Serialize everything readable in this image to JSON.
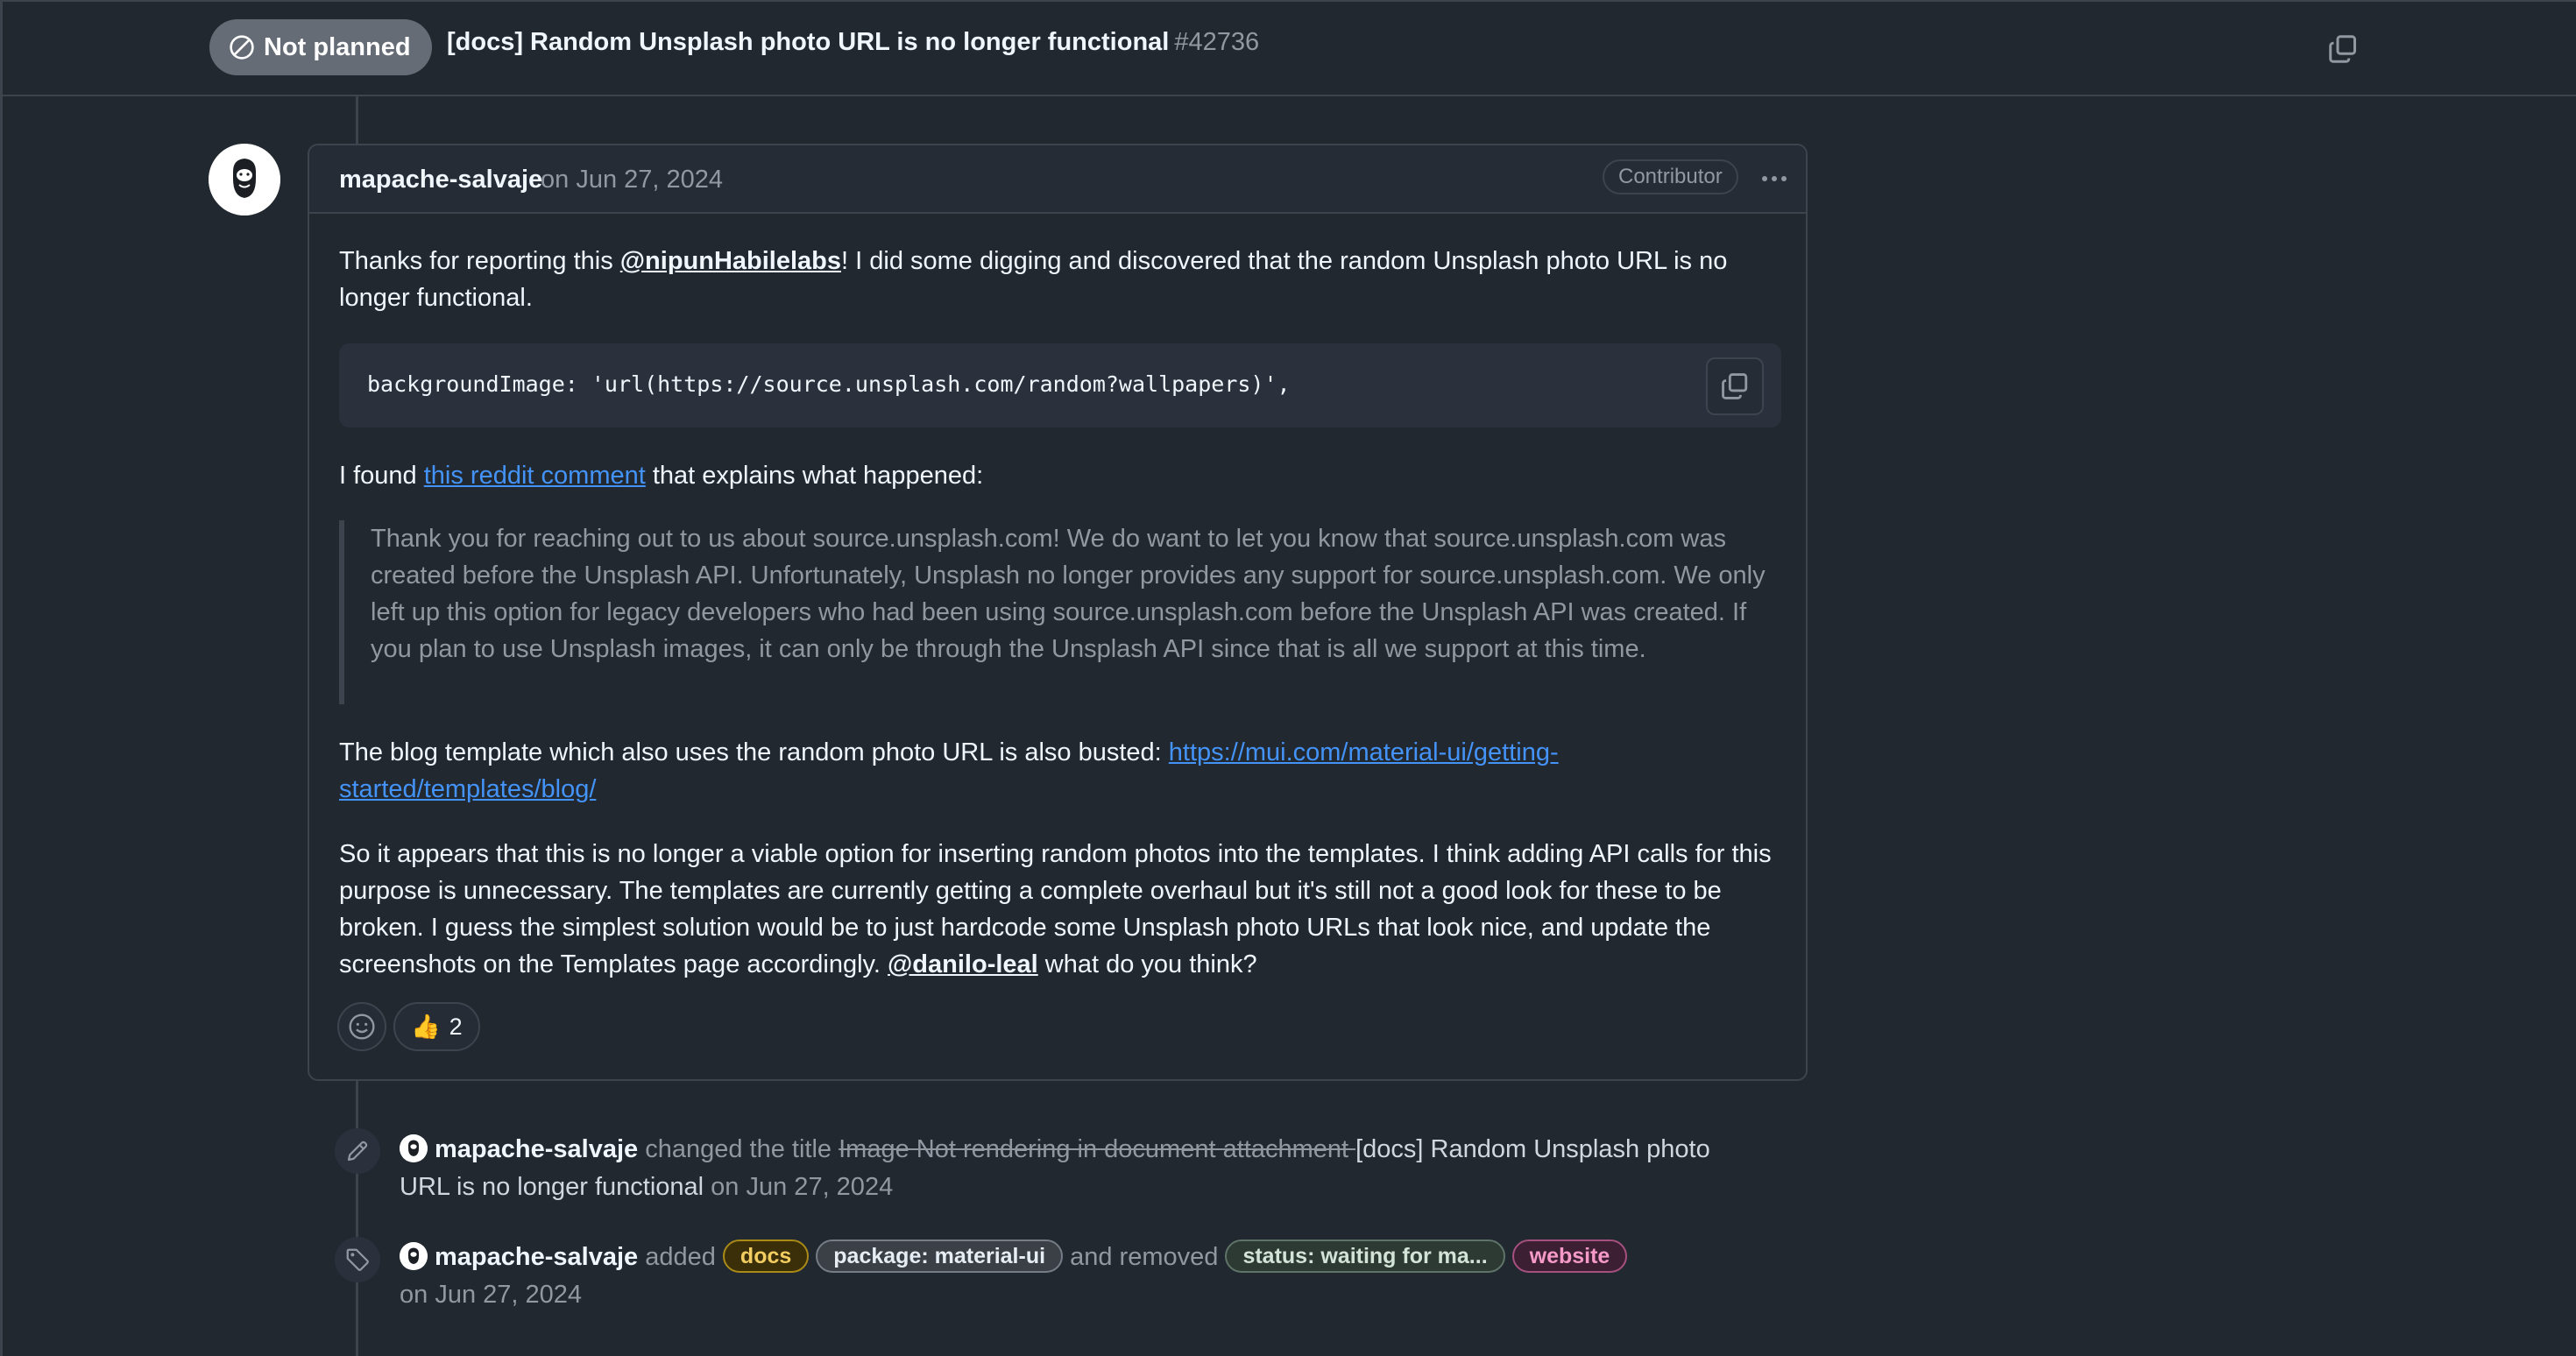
{
  "header": {
    "state": "Not planned",
    "title": "[docs] Random Unsplash photo URL is no longer functional",
    "number": "#42736"
  },
  "comment": {
    "author": "mapache-salvaje",
    "date": "on Jun 27, 2024",
    "role_badge": "Contributor",
    "p1_before": "Thanks for reporting this ",
    "p1_mention": "@nipunHabilelabs",
    "p1_after": "! I did some digging and discovered that the random Unsplash photo URL is no longer functional.",
    "code": "backgroundImage: 'url(https://source.unsplash.com/random?wallpapers)',",
    "p2_before": "I found ",
    "p2_link": "this reddit comment",
    "p2_after": " that explains what happened:",
    "quote": "Thank you for reaching out to us about source.unsplash.com! We do want to let you know that source.unsplash.com was created before the Unsplash API. Unfortunately, Unsplash no longer provides any support for source.unsplash.com. We only left up this option for legacy developers who had been using source.unsplash.com before the Unsplash API was created. If you plan to use Unsplash images, it can only be through the Unsplash API since that is all we support at this time.",
    "p3_before": "The blog template which also uses the random photo URL is also busted: ",
    "p3_link": "https://mui.com/material-ui/getting-started/templates/blog/",
    "p4_before": "So it appears that this is no longer a viable option for inserting random photos into the templates. I think adding API calls for this purpose is unnecessary. The templates are currently getting a complete overhaul but it's still not a good look for these to be broken. I guess the simplest solution would be to just hardcode some Unsplash photo URLs that look nice, and update the screenshots on the Templates page accordingly. ",
    "p4_mention": "@danilo-leal",
    "p4_after": " what do you think?",
    "reaction_emoji": "👍",
    "reaction_count": "2"
  },
  "events": {
    "rename": {
      "author": "mapache-salvaje",
      "action": " changed the title ",
      "old_title": "Image Not rendering in document attachment ",
      "new_title": "[docs] Random Unsplash photo URL is no longer functional",
      "date": " on Jun 27, 2024"
    },
    "labels": {
      "author": "mapache-salvaje",
      "added": " added ",
      "removed": " and removed ",
      "date": "on Jun 27, 2024",
      "added_labels": [
        {
          "name": "docs",
          "bg": "#3b2f0a",
          "border": "#a98a17",
          "color": "#f2cc60"
        },
        {
          "name": "package: material-ui",
          "bg": "#3b3f46",
          "border": "#767d86",
          "color": "#e6edf3"
        }
      ],
      "removed_labels": [
        {
          "name": "status: waiting for ma...",
          "bg": "#2d3a33",
          "border": "#5f7468",
          "color": "#d3e3d8"
        },
        {
          "name": "website",
          "bg": "#3d1f33",
          "border": "#a5507f",
          "color": "#f59ac8"
        }
      ]
    }
  },
  "colors": {
    "background": "#212830",
    "border": "#3d444d",
    "link": "#4493f8",
    "muted": "#9198a1",
    "closed_badge": "#656c76"
  }
}
